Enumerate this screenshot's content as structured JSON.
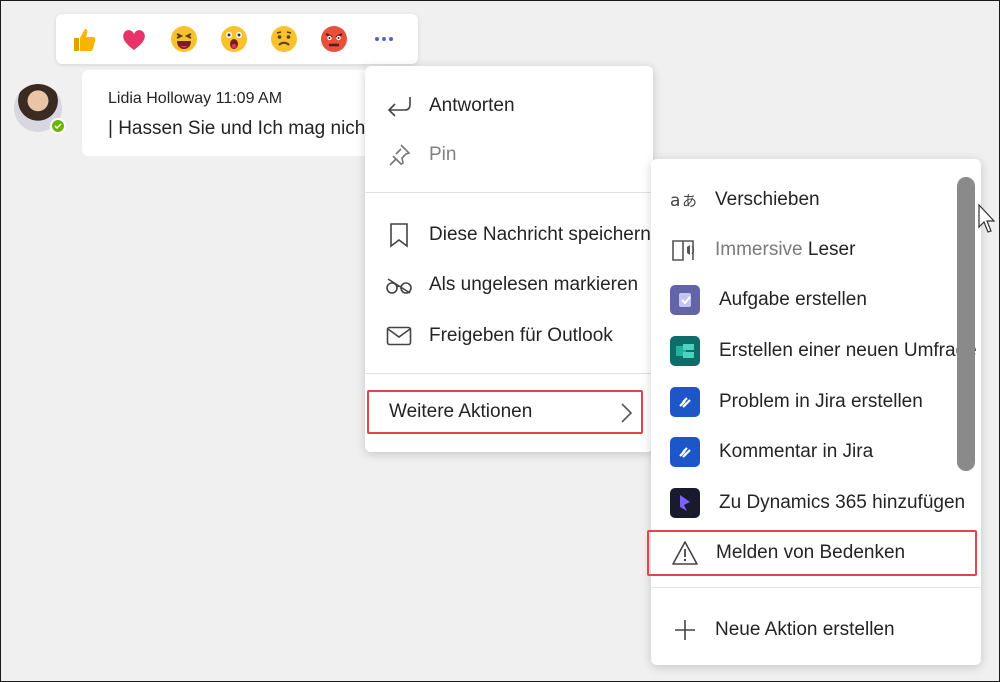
{
  "reactions": {
    "items": [
      {
        "name": "like-emoji"
      },
      {
        "name": "heart-emoji"
      },
      {
        "name": "laugh-emoji"
      },
      {
        "name": "surprised-emoji"
      },
      {
        "name": "sad-emoji"
      },
      {
        "name": "angry-emoji"
      }
    ],
    "more_icon": "more-options-icon"
  },
  "message": {
    "author": "Lidia Holloway",
    "time": "11:09 AM",
    "text": "| Hassen Sie und Ich mag nicht )",
    "presence": "available"
  },
  "context_menu": {
    "items": [
      {
        "label": "Antworten",
        "icon": "reply-icon"
      },
      {
        "label": "Pin",
        "icon": "pin-icon",
        "disabled": true
      },
      {
        "label": "Diese Nachricht speichern",
        "icon": "bookmark-icon"
      },
      {
        "label": "Als ungelesen markieren",
        "icon": "mark-unread-icon"
      },
      {
        "label": "Freigeben für Outlook",
        "icon": "mail-icon"
      }
    ],
    "more_actions": {
      "label": "Weitere Aktionen",
      "icon": "chevron-right-icon"
    }
  },
  "submenu": {
    "items": [
      {
        "label": "Verschieben",
        "icon": "translate-icon"
      },
      {
        "label_part1": "Immersive",
        "label_part2": " Leser",
        "icon": "immersive-reader-icon"
      },
      {
        "label": "Aufgabe erstellen",
        "icon": "tasks-app-icon"
      },
      {
        "label": "Erstellen einer neuen Umfrage",
        "icon": "forms-app-icon"
      },
      {
        "label": "Problem in Jira erstellen",
        "icon": "jira-app-icon"
      },
      {
        "label": "Kommentar in Jira",
        "icon": "jira-app-icon"
      },
      {
        "label": "Zu Dynamics 365 hinzufügen",
        "icon": "dynamics-app-icon"
      },
      {
        "label": "Melden von Bedenken",
        "icon": "warning-icon"
      },
      {
        "label": "Neue Aktion erstellen",
        "icon": "add-icon"
      }
    ]
  },
  "colors": {
    "accent": "#5b5fc7",
    "highlight_border": "#e0464c",
    "presence": "#6bb700"
  }
}
